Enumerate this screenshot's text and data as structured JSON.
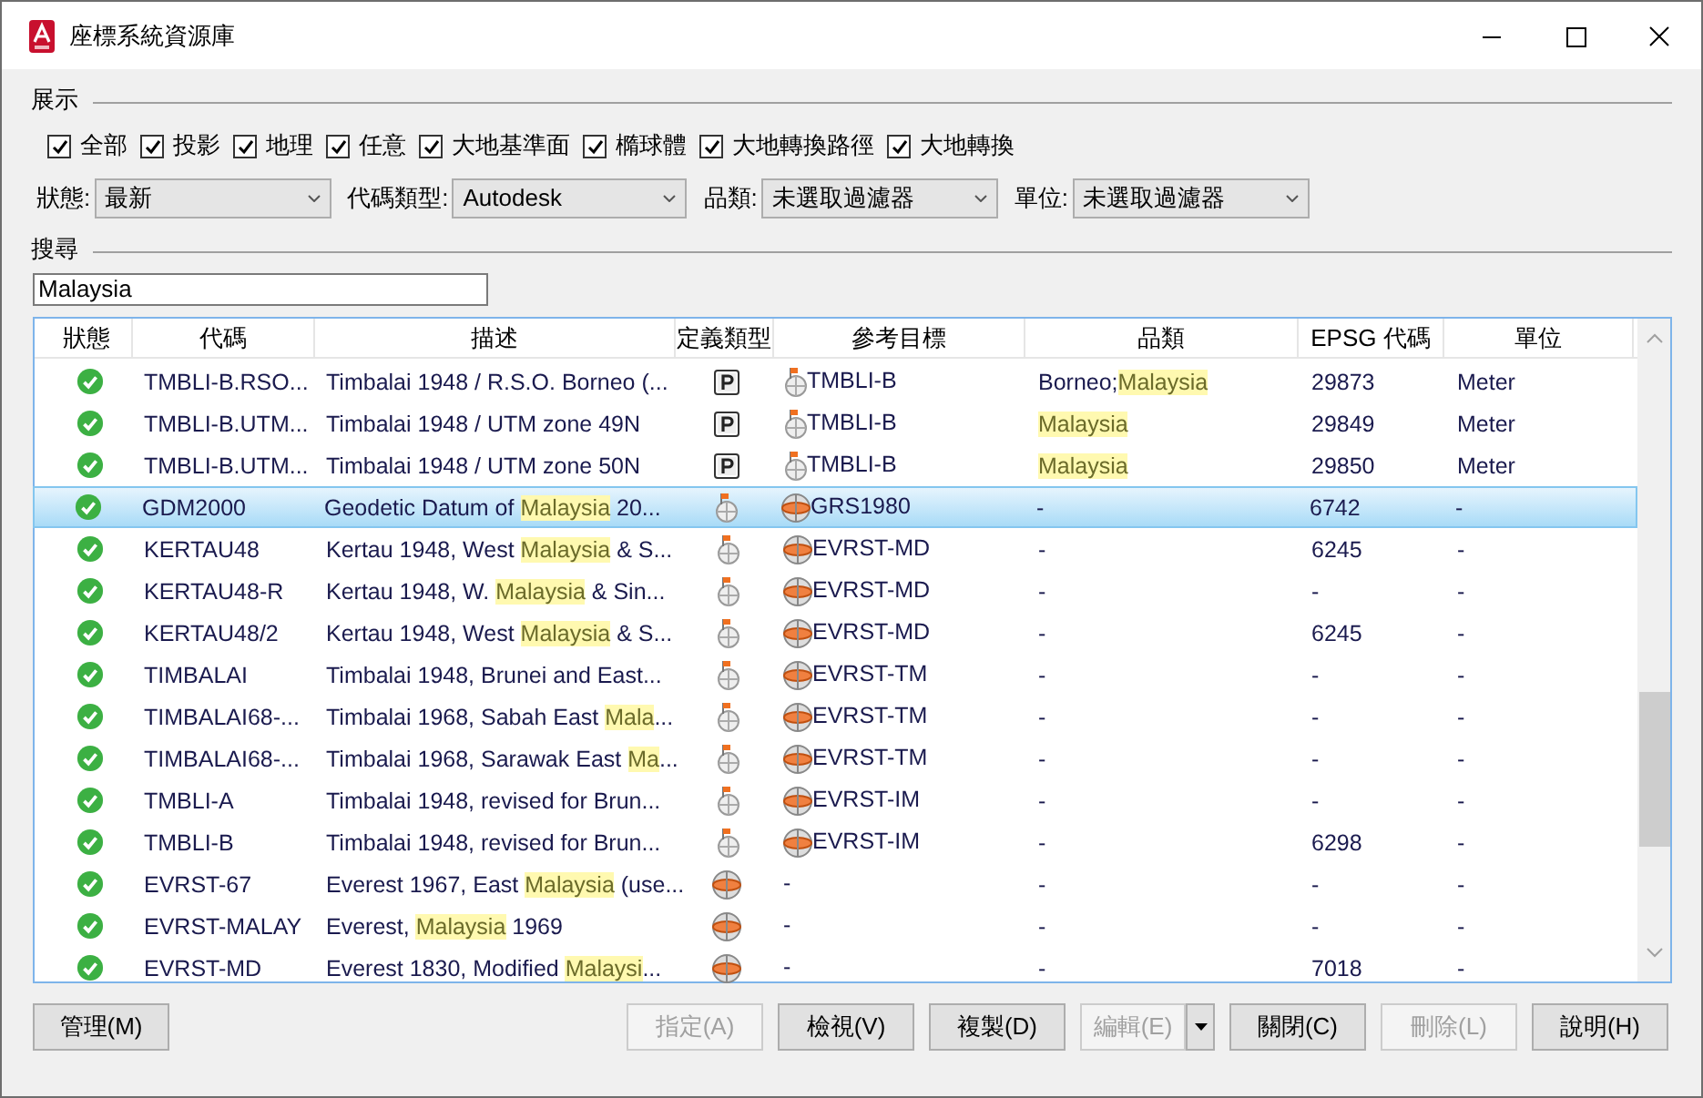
{
  "window": {
    "title": "座標系統資源庫"
  },
  "display": {
    "label": "展示",
    "filters": [
      {
        "label": "全部",
        "checked": true
      },
      {
        "label": "投影",
        "checked": true
      },
      {
        "label": "地理",
        "checked": true
      },
      {
        "label": "任意",
        "checked": true
      },
      {
        "label": "大地基準面",
        "checked": true
      },
      {
        "label": "橢球體",
        "checked": true
      },
      {
        "label": "大地轉換路徑",
        "checked": true
      },
      {
        "label": "大地轉換",
        "checked": true
      }
    ]
  },
  "dropdowns": [
    {
      "label": "狀態:",
      "value": "最新"
    },
    {
      "label": "代碼類型:",
      "value": "Autodesk"
    },
    {
      "label": "品類:",
      "value": "未選取過濾器"
    },
    {
      "label": "單位:",
      "value": "未選取過濾器"
    }
  ],
  "search": {
    "label": "搜尋",
    "value": "Malaysia"
  },
  "table": {
    "columns": [
      "狀態",
      "代碼",
      "描述",
      "定義類型",
      "參考目標",
      "品類",
      "EPSG 代碼",
      "單位"
    ],
    "rows": [
      {
        "status": {
          "kind": "ok"
        },
        "code": "TMBLI-B.RSO...",
        "description": [
          {
            "text": "Timbalai 1948 / R.S.O. Borneo (...",
            "highlight": false
          }
        ],
        "def_type": {
          "kind": "projected"
        },
        "reference": {
          "kind": "geographic",
          "text": "TMBLI-B"
        },
        "category": [
          {
            "text": "Borneo;",
            "highlight": false
          },
          {
            "text": "Malaysia",
            "highlight": true
          }
        ],
        "epsg": "29873",
        "unit": "Meter",
        "selected": false
      },
      {
        "status": {
          "kind": "ok"
        },
        "code": "TMBLI-B.UTM...",
        "description": [
          {
            "text": "Timbalai 1948 / UTM zone 49N",
            "highlight": false
          }
        ],
        "def_type": {
          "kind": "projected"
        },
        "reference": {
          "kind": "geographic",
          "text": "TMBLI-B"
        },
        "category": [
          {
            "text": "Malaysia",
            "highlight": true
          }
        ],
        "epsg": "29849",
        "unit": "Meter",
        "selected": false
      },
      {
        "status": {
          "kind": "ok"
        },
        "code": "TMBLI-B.UTM...",
        "description": [
          {
            "text": "Timbalai 1948 / UTM zone 50N",
            "highlight": false
          }
        ],
        "def_type": {
          "kind": "projected"
        },
        "reference": {
          "kind": "geographic",
          "text": "TMBLI-B"
        },
        "category": [
          {
            "text": "Malaysia",
            "highlight": true
          }
        ],
        "epsg": "29850",
        "unit": "Meter",
        "selected": false
      },
      {
        "status": {
          "kind": "ok"
        },
        "code": "GDM2000",
        "description": [
          {
            "text": "Geodetic Datum of ",
            "highlight": false
          },
          {
            "text": "Malaysia",
            "highlight": true
          },
          {
            "text": " 20...",
            "highlight": false
          }
        ],
        "def_type": {
          "kind": "geographic"
        },
        "reference": {
          "kind": "datum",
          "text": "GRS1980"
        },
        "category": [
          {
            "text": "-",
            "highlight": false
          }
        ],
        "epsg": "6742",
        "unit": "-",
        "selected": true
      },
      {
        "status": {
          "kind": "ok"
        },
        "code": "KERTAU48",
        "description": [
          {
            "text": "Kertau 1948, West ",
            "highlight": false
          },
          {
            "text": "Malaysia",
            "highlight": true
          },
          {
            "text": " & S...",
            "highlight": false
          }
        ],
        "def_type": {
          "kind": "geographic"
        },
        "reference": {
          "kind": "datum",
          "text": "EVRST-MD"
        },
        "category": [
          {
            "text": "-",
            "highlight": false
          }
        ],
        "epsg": "6245",
        "unit": "-",
        "selected": false
      },
      {
        "status": {
          "kind": "ok"
        },
        "code": "KERTAU48-R",
        "description": [
          {
            "text": "Kertau 1948, W. ",
            "highlight": false
          },
          {
            "text": "Malaysia",
            "highlight": true
          },
          {
            "text": " & Sin...",
            "highlight": false
          }
        ],
        "def_type": {
          "kind": "geographic"
        },
        "reference": {
          "kind": "datum",
          "text": "EVRST-MD"
        },
        "category": [
          {
            "text": "-",
            "highlight": false
          }
        ],
        "epsg": "-",
        "unit": "-",
        "selected": false
      },
      {
        "status": {
          "kind": "ok"
        },
        "code": "KERTAU48/2",
        "description": [
          {
            "text": "Kertau 1948, West ",
            "highlight": false
          },
          {
            "text": "Malaysia",
            "highlight": true
          },
          {
            "text": " & S...",
            "highlight": false
          }
        ],
        "def_type": {
          "kind": "geographic"
        },
        "reference": {
          "kind": "datum",
          "text": "EVRST-MD"
        },
        "category": [
          {
            "text": "-",
            "highlight": false
          }
        ],
        "epsg": "6245",
        "unit": "-",
        "selected": false
      },
      {
        "status": {
          "kind": "ok"
        },
        "code": "TIMBALAI",
        "description": [
          {
            "text": "Timbalai 1948, Brunei and East...",
            "highlight": false
          }
        ],
        "def_type": {
          "kind": "geographic"
        },
        "reference": {
          "kind": "datum",
          "text": "EVRST-TM"
        },
        "category": [
          {
            "text": "-",
            "highlight": false
          }
        ],
        "epsg": "-",
        "unit": "-",
        "selected": false
      },
      {
        "status": {
          "kind": "ok"
        },
        "code": "TIMBALAI68-...",
        "description": [
          {
            "text": "Timbalai 1968, Sabah East ",
            "highlight": false
          },
          {
            "text": "Mala",
            "highlight": true
          },
          {
            "text": "...",
            "highlight": false
          }
        ],
        "def_type": {
          "kind": "geographic"
        },
        "reference": {
          "kind": "datum",
          "text": "EVRST-TM"
        },
        "category": [
          {
            "text": "-",
            "highlight": false
          }
        ],
        "epsg": "-",
        "unit": "-",
        "selected": false
      },
      {
        "status": {
          "kind": "ok"
        },
        "code": "TIMBALAI68-...",
        "description": [
          {
            "text": "Timbalai 1968, Sarawak East ",
            "highlight": false
          },
          {
            "text": "Ma",
            "highlight": true
          },
          {
            "text": "...",
            "highlight": false
          }
        ],
        "def_type": {
          "kind": "geographic"
        },
        "reference": {
          "kind": "datum",
          "text": "EVRST-TM"
        },
        "category": [
          {
            "text": "-",
            "highlight": false
          }
        ],
        "epsg": "-",
        "unit": "-",
        "selected": false
      },
      {
        "status": {
          "kind": "ok"
        },
        "code": "TMBLI-A",
        "description": [
          {
            "text": "Timbalai 1948, revised for Brun...",
            "highlight": false
          }
        ],
        "def_type": {
          "kind": "geographic"
        },
        "reference": {
          "kind": "datum",
          "text": "EVRST-IM"
        },
        "category": [
          {
            "text": "-",
            "highlight": false
          }
        ],
        "epsg": "-",
        "unit": "-",
        "selected": false
      },
      {
        "status": {
          "kind": "ok"
        },
        "code": "TMBLI-B",
        "description": [
          {
            "text": "Timbalai 1948, revised for Brun...",
            "highlight": false
          }
        ],
        "def_type": {
          "kind": "geographic"
        },
        "reference": {
          "kind": "datum",
          "text": "EVRST-IM"
        },
        "category": [
          {
            "text": "-",
            "highlight": false
          }
        ],
        "epsg": "6298",
        "unit": "-",
        "selected": false
      },
      {
        "status": {
          "kind": "ok"
        },
        "code": "EVRST-67",
        "description": [
          {
            "text": "Everest 1967, East ",
            "highlight": false
          },
          {
            "text": "Malaysia",
            "highlight": true
          },
          {
            "text": " (use...",
            "highlight": false
          }
        ],
        "def_type": {
          "kind": "datum"
        },
        "reference": {
          "kind": "none",
          "text": "-"
        },
        "category": [
          {
            "text": "-",
            "highlight": false
          }
        ],
        "epsg": "-",
        "unit": "-",
        "selected": false
      },
      {
        "status": {
          "kind": "ok"
        },
        "code": "EVRST-MALAY",
        "description": [
          {
            "text": "Everest, ",
            "highlight": false
          },
          {
            "text": "Malaysia",
            "highlight": true
          },
          {
            "text": " 1969",
            "highlight": false
          }
        ],
        "def_type": {
          "kind": "datum"
        },
        "reference": {
          "kind": "none",
          "text": "-"
        },
        "category": [
          {
            "text": "-",
            "highlight": false
          }
        ],
        "epsg": "-",
        "unit": "-",
        "selected": false
      },
      {
        "status": {
          "kind": "ok"
        },
        "code": "EVRST-MD",
        "description": [
          {
            "text": "Everest 1830, Modified ",
            "highlight": false
          },
          {
            "text": "Malaysi",
            "highlight": true
          },
          {
            "text": "...",
            "highlight": false
          }
        ],
        "def_type": {
          "kind": "datum"
        },
        "reference": {
          "kind": "none",
          "text": "-"
        },
        "category": [
          {
            "text": "-",
            "highlight": false
          }
        ],
        "epsg": "7018",
        "unit": "-",
        "selected": false
      }
    ]
  },
  "buttons": [
    {
      "label": "管理(M)",
      "disabled": false,
      "kind": "left"
    },
    {
      "label": "指定(A)",
      "disabled": true,
      "kind": "plain"
    },
    {
      "label": "檢視(V)",
      "disabled": false,
      "kind": "plain"
    },
    {
      "label": "複製(D)",
      "disabled": false,
      "kind": "plain"
    },
    {
      "label": "編輯(E)",
      "disabled": true,
      "kind": "split"
    },
    {
      "label": "關閉(C)",
      "disabled": false,
      "kind": "plain"
    },
    {
      "label": "刪除(L)",
      "disabled": true,
      "kind": "plain"
    },
    {
      "label": "說明(H)",
      "disabled": false,
      "kind": "plain"
    }
  ]
}
